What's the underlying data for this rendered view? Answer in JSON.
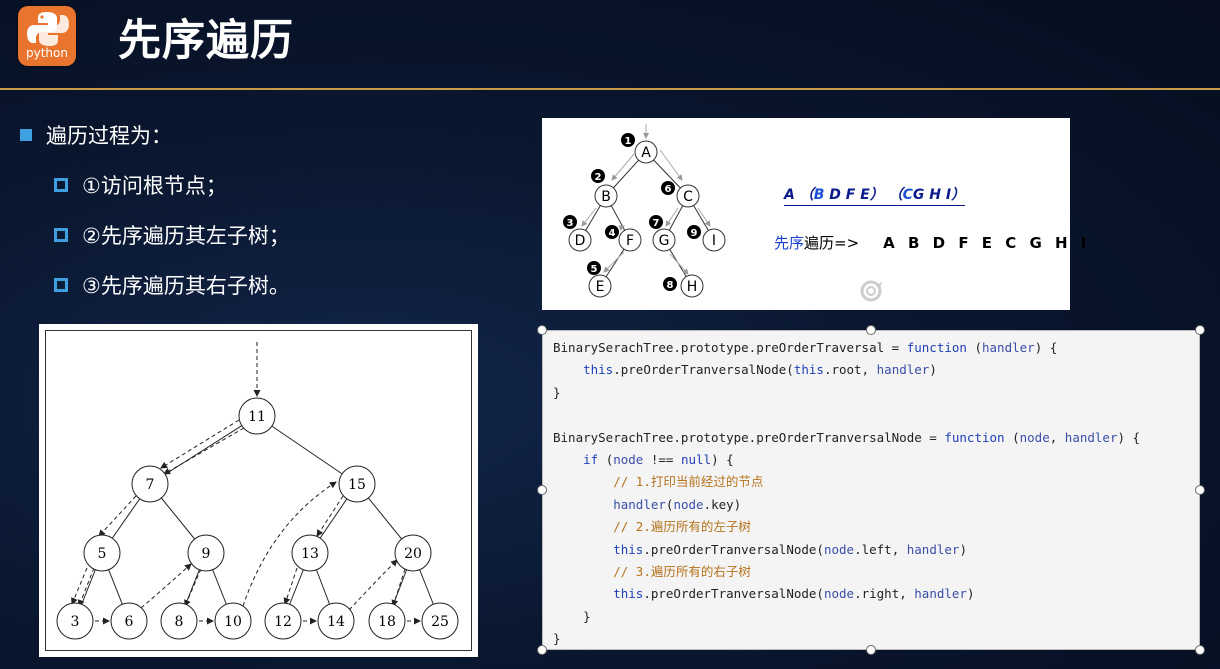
{
  "header": {
    "logo_text": "python",
    "title": "先序遍历"
  },
  "bullets": {
    "main": "遍历过程为：",
    "items": [
      "①访问根节点；",
      "②先序遍历其左子树；",
      "③先序遍历其右子树。"
    ]
  },
  "top_diagram": {
    "nodes": [
      "A",
      "B",
      "C",
      "D",
      "F",
      "G",
      "I",
      "E",
      "H"
    ],
    "step_numbers": [
      "1",
      "2",
      "3",
      "4",
      "5",
      "6",
      "7",
      "8",
      "9"
    ],
    "sequence": {
      "root": "A",
      "left_root": "B",
      "left_rest": "D F E",
      "right_root": "C",
      "right_rest": "G H I",
      "open": "（",
      "close": "）"
    },
    "preorder_label_blue": "先序",
    "preorder_label_rest": "遍历=>",
    "preorder_result": "A B D F E C G H I"
  },
  "bst_diagram": {
    "nodes": [
      "11",
      "7",
      "15",
      "5",
      "9",
      "13",
      "20",
      "3",
      "6",
      "8",
      "10",
      "12",
      "14",
      "18",
      "25"
    ]
  },
  "code": {
    "lines": [
      {
        "indent": 0,
        "parts": [
          [
            "t",
            "BinarySerachTree.prototype.preOrderTraversal = "
          ],
          [
            "kw",
            "function"
          ],
          [
            "t",
            " ("
          ],
          [
            "par",
            "handler"
          ],
          [
            "t",
            ") {"
          ]
        ]
      },
      {
        "indent": 1,
        "parts": [
          [
            "kw",
            "this"
          ],
          [
            "t",
            ".preOrderTranversalNode("
          ],
          [
            "kw",
            "this"
          ],
          [
            "t",
            ".root, "
          ],
          [
            "par",
            "handler"
          ],
          [
            "t",
            ")"
          ]
        ]
      },
      {
        "indent": 0,
        "parts": [
          [
            "t",
            "}"
          ]
        ]
      },
      {
        "indent": 0,
        "parts": []
      },
      {
        "indent": 0,
        "parts": [
          [
            "t",
            "BinarySerachTree.prototype.preOrderTranversalNode = "
          ],
          [
            "kw",
            "function"
          ],
          [
            "t",
            " ("
          ],
          [
            "par",
            "node"
          ],
          [
            "t",
            ", "
          ],
          [
            "par",
            "handler"
          ],
          [
            "t",
            ") {"
          ]
        ]
      },
      {
        "indent": 1,
        "parts": [
          [
            "kw",
            "if"
          ],
          [
            "t",
            " ("
          ],
          [
            "par",
            "node"
          ],
          [
            "t",
            " !== "
          ],
          [
            "kw",
            "null"
          ],
          [
            "t",
            ") {"
          ]
        ]
      },
      {
        "indent": 2,
        "parts": [
          [
            "cm",
            "// 1.打印当前经过的节点"
          ]
        ]
      },
      {
        "indent": 2,
        "parts": [
          [
            "par",
            "handler"
          ],
          [
            "t",
            "("
          ],
          [
            "par",
            "node"
          ],
          [
            "t",
            ".key)"
          ]
        ]
      },
      {
        "indent": 2,
        "parts": [
          [
            "cm",
            "// 2.遍历所有的左子树"
          ]
        ]
      },
      {
        "indent": 2,
        "parts": [
          [
            "kw",
            "this"
          ],
          [
            "t",
            ".preOrderTranversalNode("
          ],
          [
            "par",
            "node"
          ],
          [
            "t",
            ".left, "
          ],
          [
            "par",
            "handler"
          ],
          [
            "t",
            ")"
          ]
        ]
      },
      {
        "indent": 2,
        "parts": [
          [
            "cm",
            "// 3.遍历所有的右子树"
          ]
        ]
      },
      {
        "indent": 2,
        "parts": [
          [
            "kw",
            "this"
          ],
          [
            "t",
            ".preOrderTranversalNode("
          ],
          [
            "par",
            "node"
          ],
          [
            "t",
            ".right, "
          ],
          [
            "par",
            "handler"
          ],
          [
            "t",
            ")"
          ]
        ]
      },
      {
        "indent": 1,
        "parts": [
          [
            "t",
            "}"
          ]
        ]
      },
      {
        "indent": 0,
        "parts": [
          [
            "t",
            "}"
          ]
        ]
      }
    ]
  }
}
